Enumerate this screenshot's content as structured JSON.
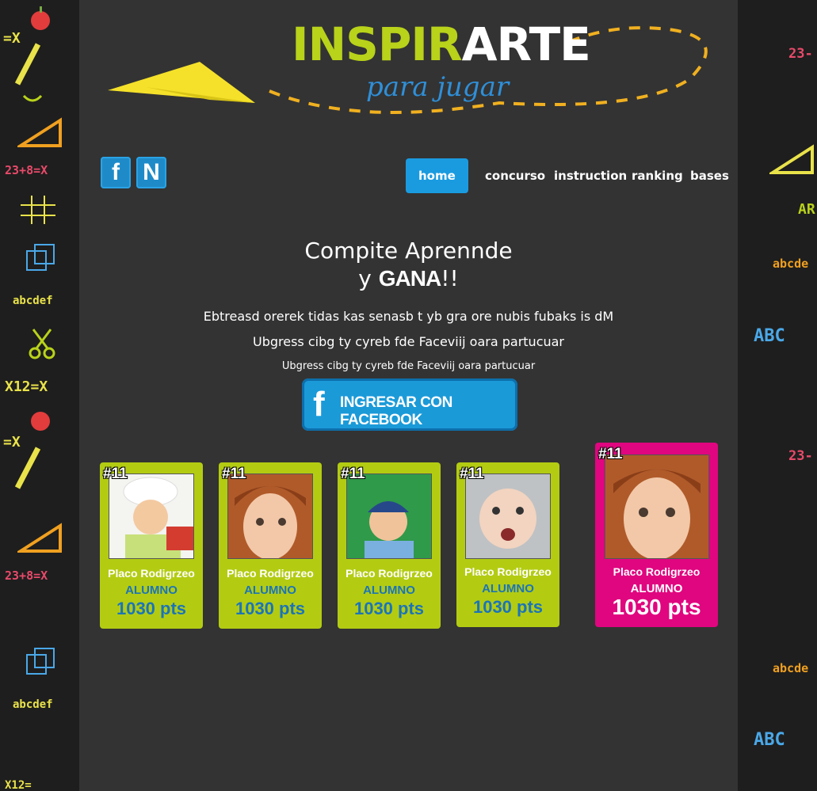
{
  "logo": {
    "title_part1": "INSPIR",
    "title_part2": "ARTE",
    "subtitle": "para jugar",
    "accent_green": "#b9d21a",
    "accent_blue": "#2f8fd8"
  },
  "social": [
    {
      "icon": "facebook-icon",
      "letter": "f"
    },
    {
      "icon": "n-icon",
      "letter": "N"
    }
  ],
  "nav": {
    "items": [
      {
        "label": "home",
        "active": true
      },
      {
        "label": "concurso"
      },
      {
        "label": "instruction"
      },
      {
        "label": "ranking"
      },
      {
        "label": "bases"
      }
    ]
  },
  "hero": {
    "line1": "Compite Aprennde",
    "line2_prefix": "y",
    "line2_gana": "GANA",
    "line2_suffix": "!!",
    "para1": "Ebtreasd orerek tidas kas senasb t yb gra ore nubis fubaks is dM",
    "para2": "Ubgress cibg ty cyreb fde Faceviij oara partucuar",
    "para3": "Ubgress cibg ty cyreb fde Faceviij oara partucuar",
    "fb_button": "INGRESAR CON FACEBOOK"
  },
  "cards": [
    {
      "rank": "#11",
      "name": "Placo Rodigrzeo",
      "role": "ALUMNO",
      "points": "1030 pts",
      "color": "#b3cc12",
      "photo": "chef-kid"
    },
    {
      "rank": "#11",
      "name": "Placo Rodigrzeo",
      "role": "ALUMNO",
      "points": "1030 pts",
      "color": "#b3cc12",
      "photo": "girl"
    },
    {
      "rank": "#11",
      "name": "Placo Rodigrzeo",
      "role": "ALUMNO",
      "points": "1030 pts",
      "color": "#b3cc12",
      "photo": "tennis-boy"
    },
    {
      "rank": "#11",
      "name": "Placo Rodigrzeo",
      "role": "ALUMNO",
      "points": "1030 pts",
      "color": "#b3cc12",
      "photo": "baby"
    },
    {
      "rank": "#11",
      "name": "Placo Rodigrzeo",
      "role": "ALUMNO",
      "points": "1030 pts",
      "color": "#e0067f",
      "photo": "girl",
      "highlight": true
    }
  ],
  "decor": {
    "left_texts": [
      "=X",
      "23+8=X",
      "abcdef",
      "X12=X",
      "=X",
      "23+8=X",
      "abcdef",
      "X12="
    ],
    "right_texts": [
      "23-",
      "AR",
      "abcde",
      "ABC",
      "23-",
      "abcde",
      "ABC"
    ]
  }
}
